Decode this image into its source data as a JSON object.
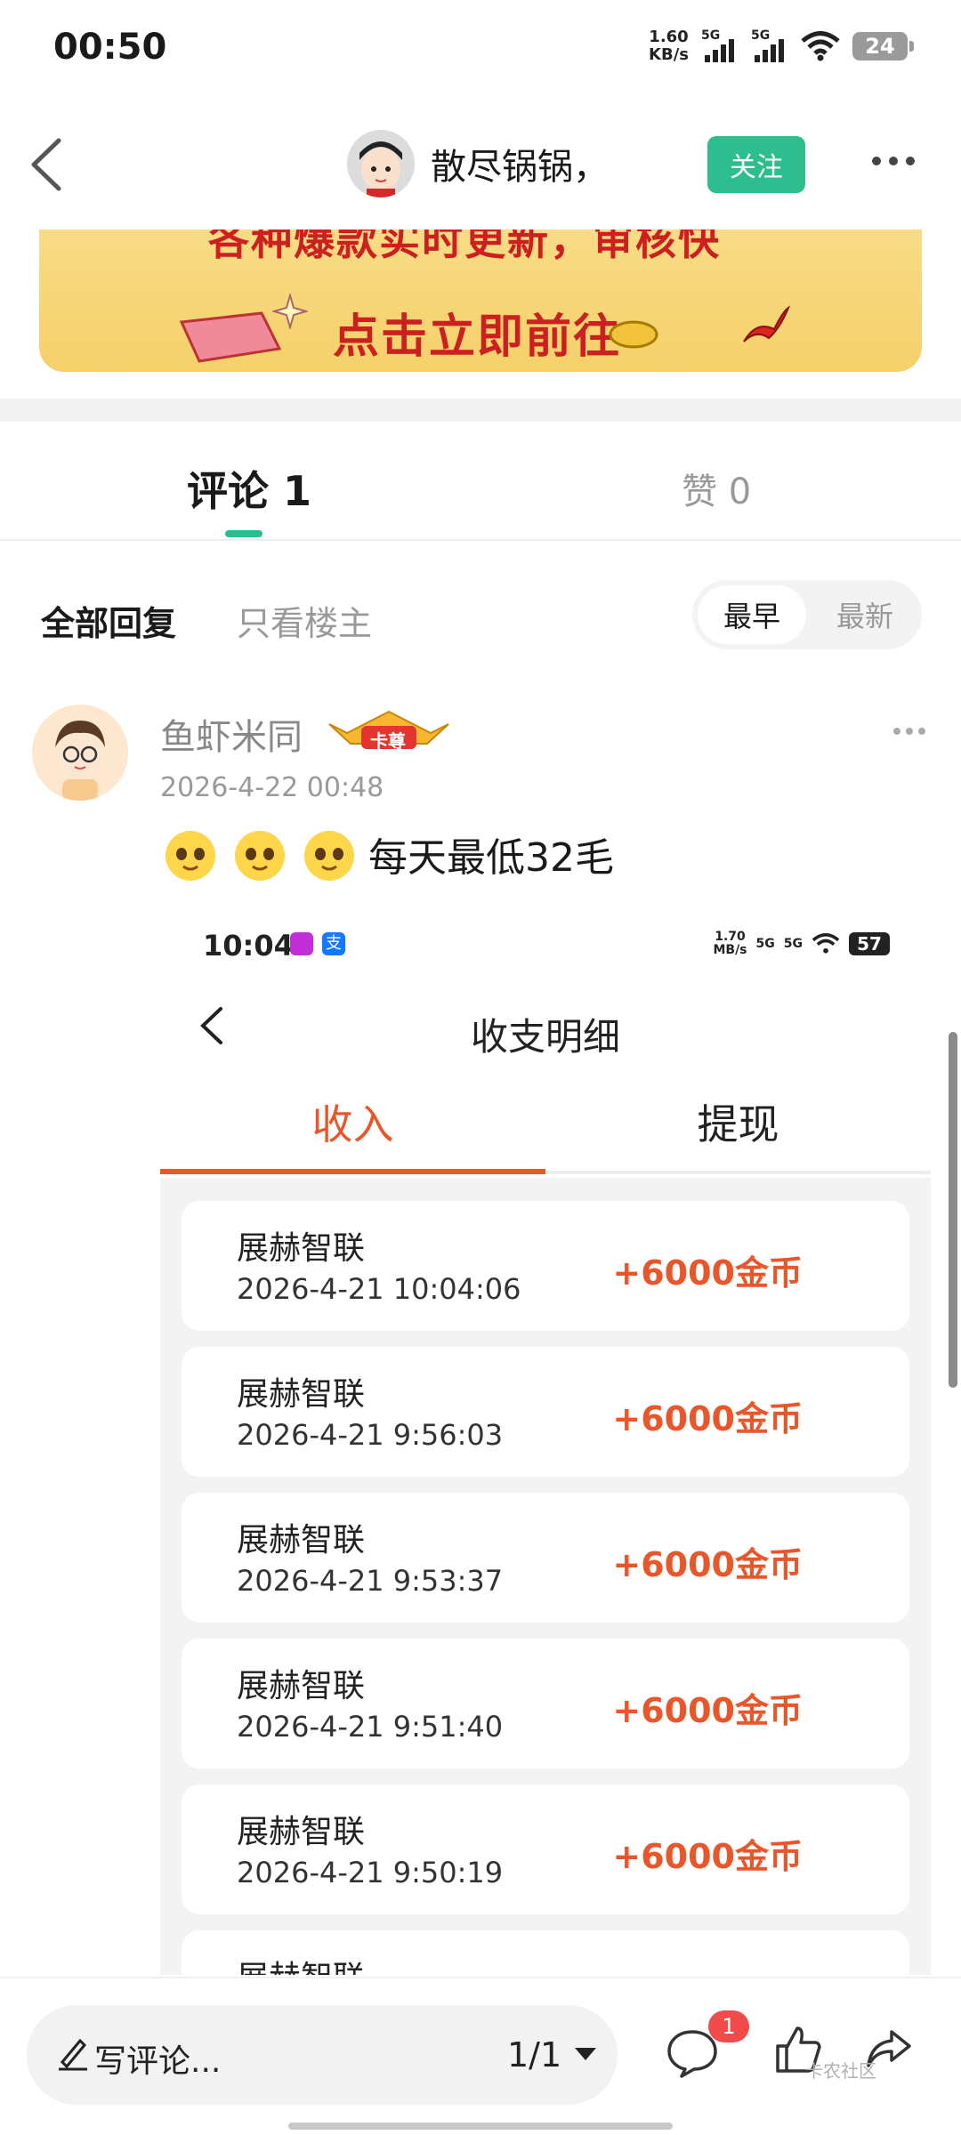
{
  "status_bar": {
    "time": "00:50",
    "net_speed": "1.60",
    "net_unit": "KB/s",
    "sim1": "5G",
    "sim2": "5G",
    "battery": "24"
  },
  "header": {
    "author_name": "散尽锅锅，",
    "follow_label": "关注"
  },
  "banner": {
    "top_text": "各种爆款实时更新，审核快",
    "cta_text": "点击立即前往"
  },
  "tabs": {
    "comments_label": "评论 1",
    "likes_label": "赞 0"
  },
  "filters": {
    "all_label": "全部回复",
    "owner_only_label": "只看楼主",
    "sort_earliest": "最早",
    "sort_latest": "最新"
  },
  "comment": {
    "username": "鱼虾米同",
    "badge_text": "卡尊",
    "time": "2026-4-22 00:48",
    "text": "每天最低32毛",
    "screenshot": {
      "status_time": "10:04",
      "app_icon2": "支",
      "net_speed": "1.70",
      "net_unit": "MB/s",
      "sim1": "5G",
      "sim2": "5G",
      "battery": "57",
      "title": "收支明细",
      "tab_income": "收入",
      "tab_withdraw": "提现",
      "records": [
        {
          "name": "展赫智联",
          "time": "2026-4-21 10:04:06",
          "amount": "+6000金币"
        },
        {
          "name": "展赫智联",
          "time": "2026-4-21 9:56:03",
          "amount": "+6000金币"
        },
        {
          "name": "展赫智联",
          "time": "2026-4-21 9:53:37",
          "amount": "+6000金币"
        },
        {
          "name": "展赫智联",
          "time": "2026-4-21 9:51:40",
          "amount": "+6000金币"
        },
        {
          "name": "展赫智联",
          "time": "2026-4-21 9:50:19",
          "amount": "+6000金币"
        },
        {
          "name": "展赫智联",
          "time": "",
          "amount": ""
        }
      ]
    }
  },
  "bottom_bar": {
    "write_placeholder": "写评论...",
    "page_indicator": "1/1",
    "comment_badge": "1",
    "watermark": "卡农社区"
  },
  "colors": {
    "accent_green": "#2ebd8e",
    "income_orange": "#e8562a",
    "badge_red": "#f24b4b"
  },
  "icons": [
    "back-icon",
    "more-icon",
    "wifi-icon",
    "signal-icon",
    "pen-icon",
    "comment-icon",
    "like-icon",
    "share-icon"
  ]
}
